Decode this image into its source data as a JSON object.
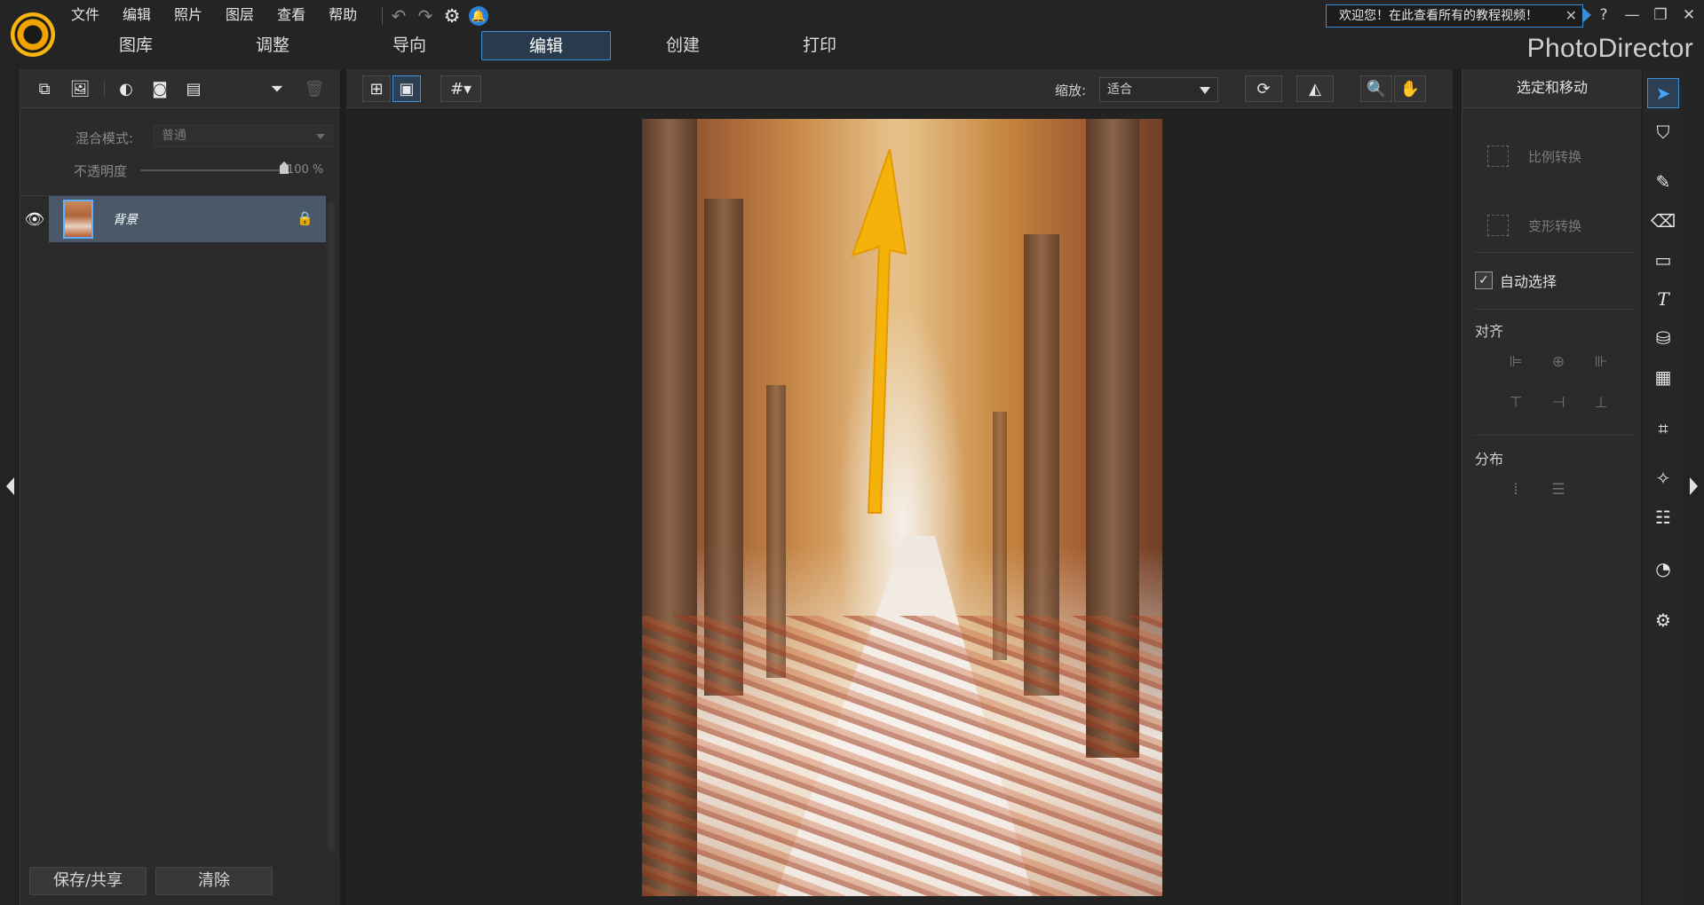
{
  "app": {
    "brand": "PhotoDirector"
  },
  "menu": [
    "文件",
    "编辑",
    "照片",
    "图层",
    "查看",
    "帮助"
  ],
  "modules": [
    {
      "label": "图库",
      "active": false
    },
    {
      "label": "调整",
      "active": false
    },
    {
      "label": "导向",
      "active": false
    },
    {
      "label": "编辑",
      "active": true
    },
    {
      "label": "创建",
      "active": false
    },
    {
      "label": "打印",
      "active": false
    }
  ],
  "welcome": {
    "text": "欢迎您！在此查看所有的教程视频！",
    "close": "✕"
  },
  "window_controls": {
    "help": "?",
    "minimize": "—",
    "restore": "❐",
    "close": "✕"
  },
  "layers_panel": {
    "blend_label": "混合模式:",
    "blend_value": "普通",
    "opacity_label": "不透明度",
    "opacity_value": "100 %",
    "opacity_level": 1.0,
    "layers": [
      {
        "name": "背景",
        "visible": true,
        "locked": true,
        "selected": true
      }
    ],
    "save_share": "保存/共享",
    "clear": "清除"
  },
  "center_toolbar": {
    "zoom_label": "缩放:",
    "zoom_value": "适合"
  },
  "right_panel": {
    "title": "选定和移动",
    "scale_transform": "比例转换",
    "warp_transform": "变形转换",
    "auto_select": "自动选择",
    "auto_select_checked": true,
    "align_heading": "对齐",
    "distribute_heading": "分布"
  },
  "icons": {
    "tool_strip": [
      "select-arrow-icon",
      "brush-selection-icon",
      "pencil-icon",
      "eraser-icon",
      "rectangle-icon",
      "text-icon",
      "paint-bucket-icon",
      "gradient-icon",
      "crop-icon",
      "magic-wand-icon",
      "adjustment-sliders-icon",
      "color-wheel-icon",
      "settings-gear-icon"
    ]
  },
  "colors": {
    "accent": "#3f8fd6",
    "annotation_arrow": "#f5b20a"
  }
}
